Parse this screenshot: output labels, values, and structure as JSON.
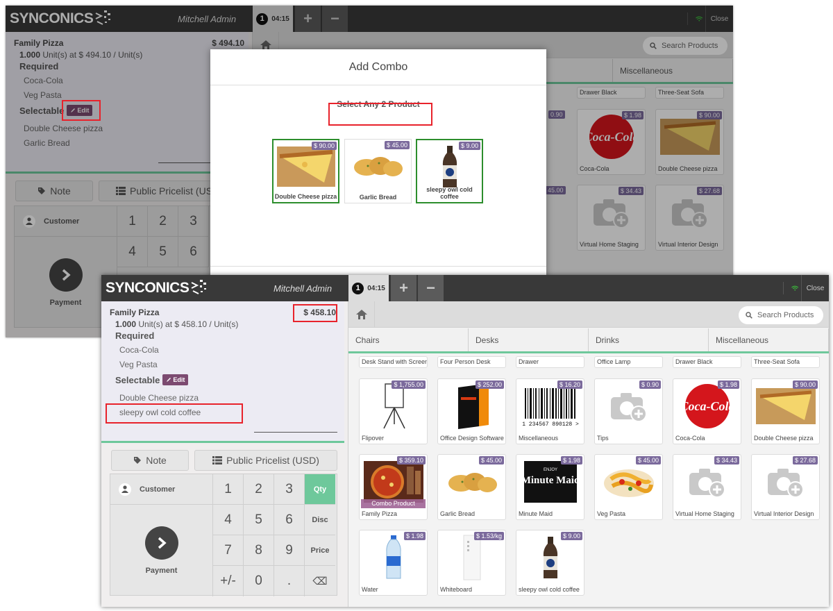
{
  "brand": "SYNCONICS",
  "user": "Mitchell Admin",
  "order_tab": {
    "number": "1",
    "time": "04:15"
  },
  "tab_plus": "+",
  "tab_minus": "−",
  "close_label": "Close",
  "search_placeholder": "Search Products",
  "categories": [
    "Chairs",
    "Desks",
    "Drinks",
    "Miscellaneous"
  ],
  "controls": {
    "note": "Note",
    "pricelist": "Public Pricelist (USD)",
    "pricelist_cut": "Public Pricelist (US",
    "customer": "Customer",
    "payment": "Payment"
  },
  "keys": [
    "1",
    "2",
    "3",
    "Qty",
    "4",
    "5",
    "6",
    "Disc",
    "7",
    "8",
    "9",
    "Price",
    "+/-",
    "0",
    ".",
    "⌫"
  ],
  "screen1": {
    "order": {
      "name": "Family Pizza",
      "price": "$ 494.10",
      "qty": "1.000",
      "unit_text": "Unit(s) at $ 494.10 / Unit(s)",
      "required": "Required",
      "req_items": [
        "Coca-Cola",
        "Veg Pasta"
      ],
      "selectable": "Selectable",
      "edit": "Edit",
      "sel_items": [
        "Double Cheese pizza",
        "Garlic Bread"
      ]
    },
    "modal": {
      "title": "Add Combo",
      "subtitle": "Select Any 2 Product",
      "items": [
        {
          "name": "Double Cheese pizza",
          "price": "$ 90.00",
          "selected": true
        },
        {
          "name": "Garlic Bread",
          "price": "$ 45.00",
          "selected": false
        },
        {
          "name": "sleepy owl cold coffee",
          "price": "$ 9.00",
          "selected": true
        }
      ]
    },
    "bg_cards": [
      {
        "name": "Drawer Black",
        "price": ""
      },
      {
        "name": "Three-Seat Sofa",
        "price": ""
      },
      {
        "name": "Coca-Cola",
        "price": "$ 1.98"
      },
      {
        "name": "Double Cheese pizza",
        "price": "$ 90.00"
      },
      {
        "name": "Virtual Home Staging",
        "price": "$ 34.43"
      },
      {
        "name": "Virtual Interior Design",
        "price": "$ 27.68"
      }
    ],
    "partial_prices": [
      "0.90",
      "45.00"
    ]
  },
  "screen2": {
    "order": {
      "name": "Family Pizza",
      "price": "$ 458.10",
      "qty": "1.000",
      "unit_text": "Unit(s) at $ 458.10 / Unit(s)",
      "required": "Required",
      "req_items": [
        "Coca-Cola",
        "Veg Pasta"
      ],
      "selectable": "Selectable",
      "edit": "Edit",
      "sel_items": [
        "Double Cheese pizza",
        "sleepy owl cold coffee"
      ]
    },
    "top_row": [
      "Desk Stand with Screen",
      "Four Person Desk",
      "Drawer",
      "Office Lamp",
      "Drawer Black",
      "Three-Seat Sofa"
    ],
    "products": [
      {
        "name": "Flipover",
        "price": "$ 1,755.00",
        "img": "flipchart"
      },
      {
        "name": "Office Design Software",
        "price": "$ 252.00",
        "img": "software"
      },
      {
        "name": "Miscellaneous",
        "price": "$ 16.20",
        "img": "barcode",
        "barcode_text": "1 234567 890128 >"
      },
      {
        "name": "Tips",
        "price": "$ 0.90",
        "img": "camera"
      },
      {
        "name": "Coca-Cola",
        "price": "$ 1.98",
        "img": "coke"
      },
      {
        "name": "Double Cheese pizza",
        "price": "$ 90.00",
        "img": "pizza"
      },
      {
        "name": "Family Pizza",
        "price": "$ 359.10",
        "img": "familypizza",
        "tag": "Combo Product"
      },
      {
        "name": "Garlic Bread",
        "price": "$ 45.00",
        "img": "bread"
      },
      {
        "name": "Minute Maid",
        "price": "$ 1.98",
        "img": "minutemaid",
        "logo_small": "ENJOY",
        "logo_big": "Minute Maid"
      },
      {
        "name": "Veg Pasta",
        "price": "$ 45.00",
        "img": "pasta"
      },
      {
        "name": "Virtual Home Staging",
        "price": "$ 34.43",
        "img": "camera"
      },
      {
        "name": "Virtual Interior Design",
        "price": "$ 27.68",
        "img": "camera"
      },
      {
        "name": "Water",
        "price": "$ 1.98",
        "img": "water"
      },
      {
        "name": "Whiteboard",
        "price": "$ 1.53/kg",
        "img": "whiteboard"
      },
      {
        "name": "sleepy owl cold coffee",
        "price": "$ 9.00",
        "img": "coffee"
      }
    ]
  },
  "colors": {
    "topbar": "#393939",
    "accent": "#6ec89b",
    "price_badge": "#7b6a9c",
    "edit": "#7c4a70",
    "highlight": "#e8222b",
    "selected": "#2c8e2c"
  }
}
